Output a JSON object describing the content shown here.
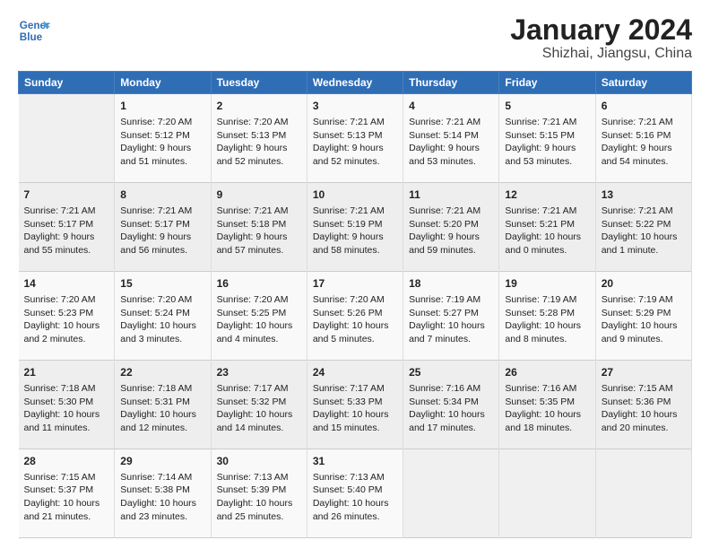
{
  "header": {
    "logo_line1": "General",
    "logo_line2": "Blue",
    "title": "January 2024",
    "subtitle": "Shizhai, Jiangsu, China"
  },
  "days_of_week": [
    "Sunday",
    "Monday",
    "Tuesday",
    "Wednesday",
    "Thursday",
    "Friday",
    "Saturday"
  ],
  "weeks": [
    [
      {
        "day": "",
        "sunrise": "",
        "sunset": "",
        "daylight": ""
      },
      {
        "day": "1",
        "sunrise": "Sunrise: 7:20 AM",
        "sunset": "Sunset: 5:12 PM",
        "daylight": "Daylight: 9 hours and 51 minutes."
      },
      {
        "day": "2",
        "sunrise": "Sunrise: 7:20 AM",
        "sunset": "Sunset: 5:13 PM",
        "daylight": "Daylight: 9 hours and 52 minutes."
      },
      {
        "day": "3",
        "sunrise": "Sunrise: 7:21 AM",
        "sunset": "Sunset: 5:13 PM",
        "daylight": "Daylight: 9 hours and 52 minutes."
      },
      {
        "day": "4",
        "sunrise": "Sunrise: 7:21 AM",
        "sunset": "Sunset: 5:14 PM",
        "daylight": "Daylight: 9 hours and 53 minutes."
      },
      {
        "day": "5",
        "sunrise": "Sunrise: 7:21 AM",
        "sunset": "Sunset: 5:15 PM",
        "daylight": "Daylight: 9 hours and 53 minutes."
      },
      {
        "day": "6",
        "sunrise": "Sunrise: 7:21 AM",
        "sunset": "Sunset: 5:16 PM",
        "daylight": "Daylight: 9 hours and 54 minutes."
      }
    ],
    [
      {
        "day": "7",
        "sunrise": "Sunrise: 7:21 AM",
        "sunset": "Sunset: 5:17 PM",
        "daylight": "Daylight: 9 hours and 55 minutes."
      },
      {
        "day": "8",
        "sunrise": "Sunrise: 7:21 AM",
        "sunset": "Sunset: 5:17 PM",
        "daylight": "Daylight: 9 hours and 56 minutes."
      },
      {
        "day": "9",
        "sunrise": "Sunrise: 7:21 AM",
        "sunset": "Sunset: 5:18 PM",
        "daylight": "Daylight: 9 hours and 57 minutes."
      },
      {
        "day": "10",
        "sunrise": "Sunrise: 7:21 AM",
        "sunset": "Sunset: 5:19 PM",
        "daylight": "Daylight: 9 hours and 58 minutes."
      },
      {
        "day": "11",
        "sunrise": "Sunrise: 7:21 AM",
        "sunset": "Sunset: 5:20 PM",
        "daylight": "Daylight: 9 hours and 59 minutes."
      },
      {
        "day": "12",
        "sunrise": "Sunrise: 7:21 AM",
        "sunset": "Sunset: 5:21 PM",
        "daylight": "Daylight: 10 hours and 0 minutes."
      },
      {
        "day": "13",
        "sunrise": "Sunrise: 7:21 AM",
        "sunset": "Sunset: 5:22 PM",
        "daylight": "Daylight: 10 hours and 1 minute."
      }
    ],
    [
      {
        "day": "14",
        "sunrise": "Sunrise: 7:20 AM",
        "sunset": "Sunset: 5:23 PM",
        "daylight": "Daylight: 10 hours and 2 minutes."
      },
      {
        "day": "15",
        "sunrise": "Sunrise: 7:20 AM",
        "sunset": "Sunset: 5:24 PM",
        "daylight": "Daylight: 10 hours and 3 minutes."
      },
      {
        "day": "16",
        "sunrise": "Sunrise: 7:20 AM",
        "sunset": "Sunset: 5:25 PM",
        "daylight": "Daylight: 10 hours and 4 minutes."
      },
      {
        "day": "17",
        "sunrise": "Sunrise: 7:20 AM",
        "sunset": "Sunset: 5:26 PM",
        "daylight": "Daylight: 10 hours and 5 minutes."
      },
      {
        "day": "18",
        "sunrise": "Sunrise: 7:19 AM",
        "sunset": "Sunset: 5:27 PM",
        "daylight": "Daylight: 10 hours and 7 minutes."
      },
      {
        "day": "19",
        "sunrise": "Sunrise: 7:19 AM",
        "sunset": "Sunset: 5:28 PM",
        "daylight": "Daylight: 10 hours and 8 minutes."
      },
      {
        "day": "20",
        "sunrise": "Sunrise: 7:19 AM",
        "sunset": "Sunset: 5:29 PM",
        "daylight": "Daylight: 10 hours and 9 minutes."
      }
    ],
    [
      {
        "day": "21",
        "sunrise": "Sunrise: 7:18 AM",
        "sunset": "Sunset: 5:30 PM",
        "daylight": "Daylight: 10 hours and 11 minutes."
      },
      {
        "day": "22",
        "sunrise": "Sunrise: 7:18 AM",
        "sunset": "Sunset: 5:31 PM",
        "daylight": "Daylight: 10 hours and 12 minutes."
      },
      {
        "day": "23",
        "sunrise": "Sunrise: 7:17 AM",
        "sunset": "Sunset: 5:32 PM",
        "daylight": "Daylight: 10 hours and 14 minutes."
      },
      {
        "day": "24",
        "sunrise": "Sunrise: 7:17 AM",
        "sunset": "Sunset: 5:33 PM",
        "daylight": "Daylight: 10 hours and 15 minutes."
      },
      {
        "day": "25",
        "sunrise": "Sunrise: 7:16 AM",
        "sunset": "Sunset: 5:34 PM",
        "daylight": "Daylight: 10 hours and 17 minutes."
      },
      {
        "day": "26",
        "sunrise": "Sunrise: 7:16 AM",
        "sunset": "Sunset: 5:35 PM",
        "daylight": "Daylight: 10 hours and 18 minutes."
      },
      {
        "day": "27",
        "sunrise": "Sunrise: 7:15 AM",
        "sunset": "Sunset: 5:36 PM",
        "daylight": "Daylight: 10 hours and 20 minutes."
      }
    ],
    [
      {
        "day": "28",
        "sunrise": "Sunrise: 7:15 AM",
        "sunset": "Sunset: 5:37 PM",
        "daylight": "Daylight: 10 hours and 21 minutes."
      },
      {
        "day": "29",
        "sunrise": "Sunrise: 7:14 AM",
        "sunset": "Sunset: 5:38 PM",
        "daylight": "Daylight: 10 hours and 23 minutes."
      },
      {
        "day": "30",
        "sunrise": "Sunrise: 7:13 AM",
        "sunset": "Sunset: 5:39 PM",
        "daylight": "Daylight: 10 hours and 25 minutes."
      },
      {
        "day": "31",
        "sunrise": "Sunrise: 7:13 AM",
        "sunset": "Sunset: 5:40 PM",
        "daylight": "Daylight: 10 hours and 26 minutes."
      },
      {
        "day": "",
        "sunrise": "",
        "sunset": "",
        "daylight": ""
      },
      {
        "day": "",
        "sunrise": "",
        "sunset": "",
        "daylight": ""
      },
      {
        "day": "",
        "sunrise": "",
        "sunset": "",
        "daylight": ""
      }
    ]
  ]
}
